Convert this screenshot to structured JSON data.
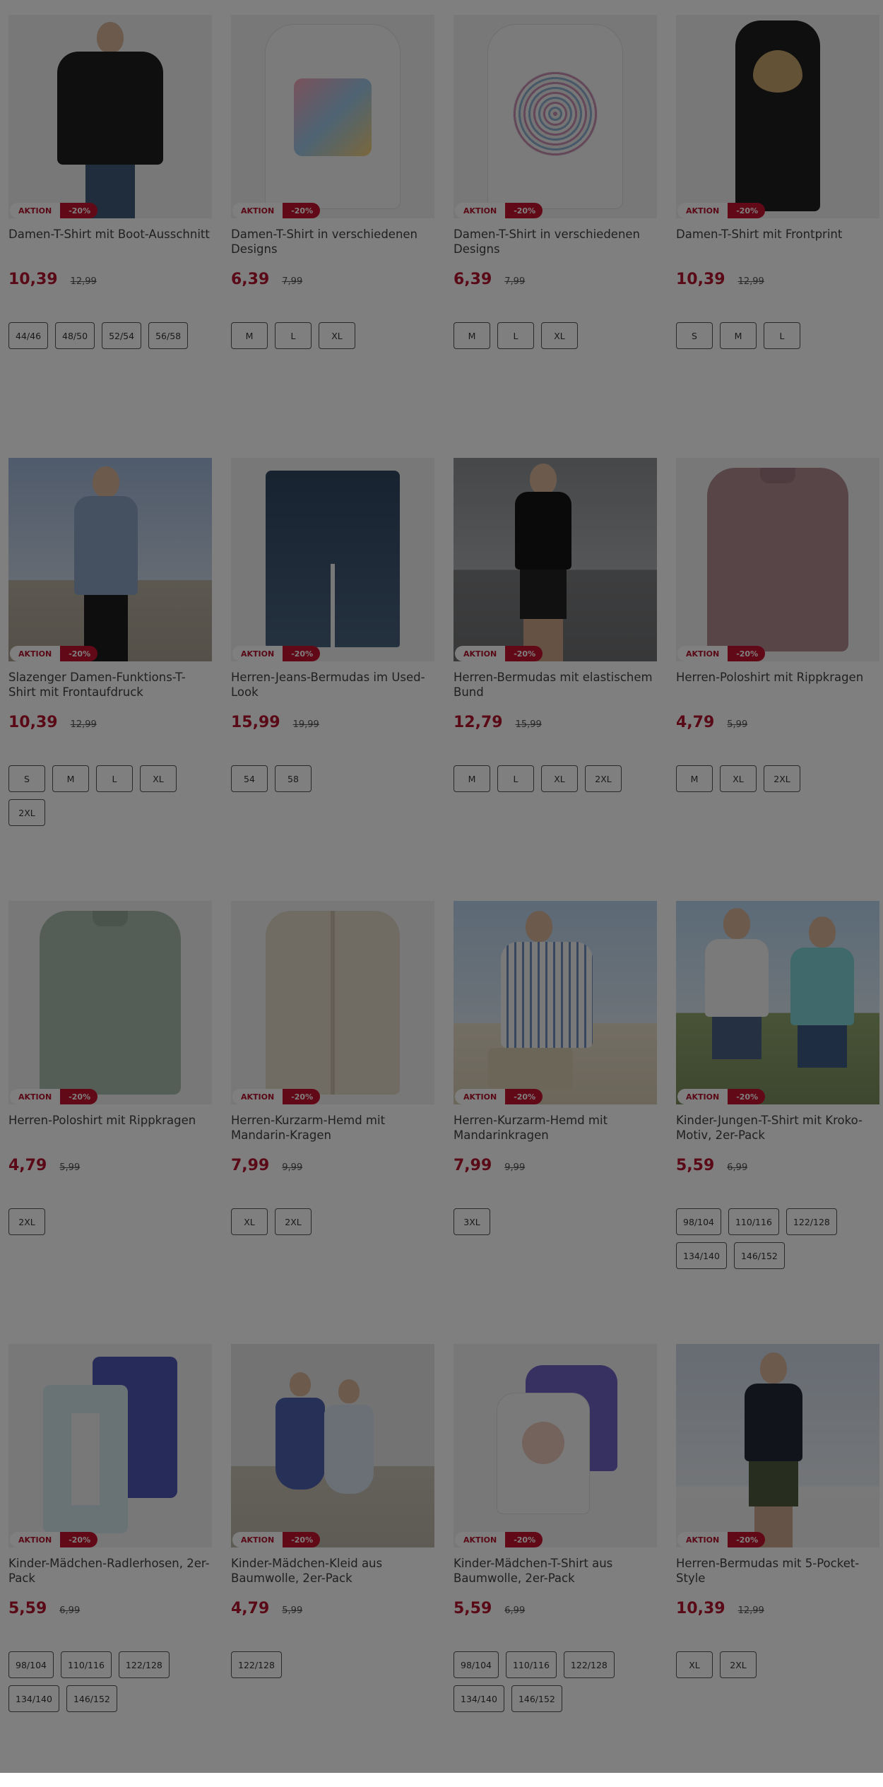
{
  "products": [
    {
      "title": "Damen-T-Shirt mit Boot-Ausschnitt",
      "price": "10,39",
      "old_price": "12,99",
      "badge": "AKTION",
      "discount": "-20%",
      "sizes": [
        "44/46",
        "48/50",
        "52/54",
        "56/58"
      ]
    },
    {
      "title": "Damen-T-Shirt in verschiedenen Designs",
      "price": "6,39",
      "old_price": "7,99",
      "badge": "AKTION",
      "discount": "-20%",
      "sizes": [
        "M",
        "L",
        "XL"
      ]
    },
    {
      "title": "Damen-T-Shirt in verschiedenen Designs",
      "price": "6,39",
      "old_price": "7,99",
      "badge": "AKTION",
      "discount": "-20%",
      "sizes": [
        "M",
        "L",
        "XL"
      ]
    },
    {
      "title": "Damen-T-Shirt mit Frontprint",
      "price": "10,39",
      "old_price": "12,99",
      "badge": "AKTION",
      "discount": "-20%",
      "sizes": [
        "S",
        "M",
        "L"
      ]
    },
    {
      "title": "Slazenger Damen-Funktions-T-Shirt mit Frontaufdruck",
      "price": "10,39",
      "old_price": "12,99",
      "badge": "AKTION",
      "discount": "-20%",
      "sizes": [
        "S",
        "M",
        "L",
        "XL",
        "2XL"
      ]
    },
    {
      "title": "Herren-Jeans-Bermudas im Used-Look",
      "price": "15,99",
      "old_price": "19,99",
      "badge": "AKTION",
      "discount": "-20%",
      "sizes": [
        "54",
        "58"
      ]
    },
    {
      "title": "Herren-Bermudas mit elastischem Bund",
      "price": "12,79",
      "old_price": "15,99",
      "badge": "AKTION",
      "discount": "-20%",
      "sizes": [
        "M",
        "L",
        "XL",
        "2XL"
      ]
    },
    {
      "title": "Herren-Poloshirt mit Rippkragen",
      "price": "4,79",
      "old_price": "5,99",
      "badge": "AKTION",
      "discount": "-20%",
      "sizes": [
        "M",
        "XL",
        "2XL"
      ]
    },
    {
      "title": "Herren-Poloshirt mit Rippkragen",
      "price": "4,79",
      "old_price": "5,99",
      "badge": "AKTION",
      "discount": "-20%",
      "sizes": [
        "2XL"
      ]
    },
    {
      "title": "Herren-Kurzarm-Hemd mit Mandarin-Kragen",
      "price": "7,99",
      "old_price": "9,99",
      "badge": "AKTION",
      "discount": "-20%",
      "sizes": [
        "XL",
        "2XL"
      ]
    },
    {
      "title": "Herren-Kurzarm-Hemd mit Mandarinkragen",
      "price": "7,99",
      "old_price": "9,99",
      "badge": "AKTION",
      "discount": "-20%",
      "sizes": [
        "3XL"
      ]
    },
    {
      "title": "Kinder-Jungen-T-Shirt mit Kroko-Motiv, 2er-Pack",
      "price": "5,59",
      "old_price": "6,99",
      "badge": "AKTION",
      "discount": "-20%",
      "sizes": [
        "98/104",
        "110/116",
        "122/128",
        "134/140",
        "146/152"
      ]
    },
    {
      "title": "Kinder-Mädchen-Radlerhosen, 2er-Pack",
      "price": "5,59",
      "old_price": "6,99",
      "badge": "AKTION",
      "discount": "-20%",
      "sizes": [
        "98/104",
        "110/116",
        "122/128",
        "134/140",
        "146/152"
      ]
    },
    {
      "title": "Kinder-Mädchen-Kleid aus Baumwolle, 2er-Pack",
      "price": "4,79",
      "old_price": "5,99",
      "badge": "AKTION",
      "discount": "-20%",
      "sizes": [
        "122/128"
      ]
    },
    {
      "title": "Kinder-Mädchen-T-Shirt aus Baumwolle, 2er-Pack",
      "price": "5,59",
      "old_price": "6,99",
      "badge": "AKTION",
      "discount": "-20%",
      "sizes": [
        "98/104",
        "110/116",
        "122/128",
        "134/140",
        "146/152"
      ]
    },
    {
      "title": "Herren-Bermudas mit 5-Pocket-Style",
      "price": "10,39",
      "old_price": "12,99",
      "badge": "AKTION",
      "discount": "-20%",
      "sizes": [
        "XL",
        "2XL"
      ]
    }
  ],
  "colors": {
    "accent": "#b5122c",
    "badge_red": "#c4122f",
    "overlay": "rgba(0,0,0,0.5)"
  }
}
